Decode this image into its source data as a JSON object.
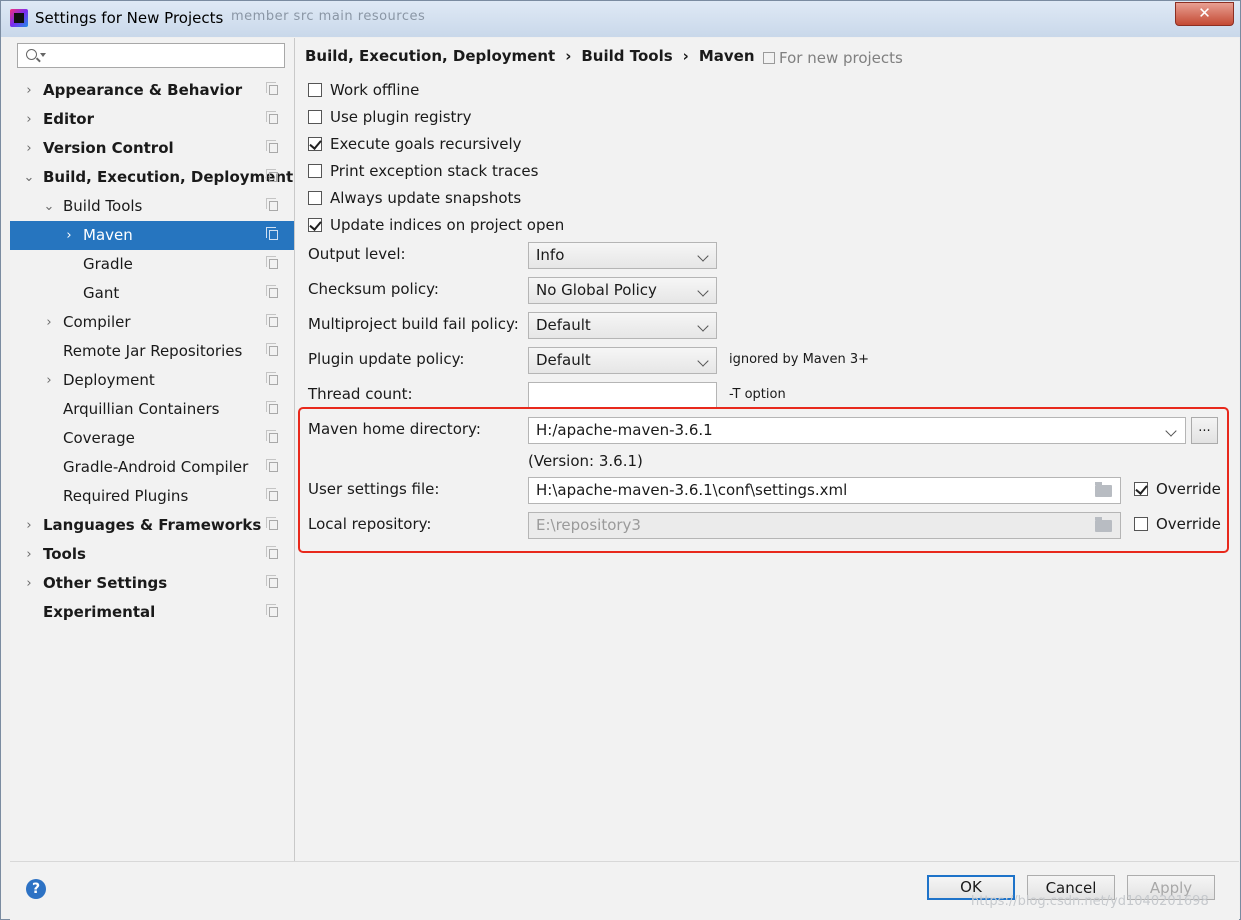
{
  "window": {
    "title": "Settings for New Projects",
    "background_tabs": "member   src   main   resources",
    "close_glyph": "✕"
  },
  "sidebar": {
    "search_placeholder": "",
    "items": [
      {
        "label": "Appearance & Behavior",
        "level": 0,
        "arrow": "›",
        "bold": true,
        "selected": false
      },
      {
        "label": "Editor",
        "level": 0,
        "arrow": "›",
        "bold": true,
        "selected": false
      },
      {
        "label": "Version Control",
        "level": 0,
        "arrow": "›",
        "bold": true,
        "selected": false
      },
      {
        "label": "Build, Execution, Deployment",
        "level": 0,
        "arrow": "⌄",
        "bold": true,
        "selected": false
      },
      {
        "label": "Build Tools",
        "level": 1,
        "arrow": "⌄",
        "bold": false,
        "selected": false
      },
      {
        "label": "Maven",
        "level": 2,
        "arrow": "›",
        "bold": false,
        "selected": true
      },
      {
        "label": "Gradle",
        "level": 2,
        "arrow": "",
        "bold": false,
        "selected": false
      },
      {
        "label": "Gant",
        "level": 2,
        "arrow": "",
        "bold": false,
        "selected": false
      },
      {
        "label": "Compiler",
        "level": 1,
        "arrow": "›",
        "bold": false,
        "selected": false
      },
      {
        "label": "Remote Jar Repositories",
        "level": 1,
        "arrow": "",
        "bold": false,
        "selected": false
      },
      {
        "label": "Deployment",
        "level": 1,
        "arrow": "›",
        "bold": false,
        "selected": false
      },
      {
        "label": "Arquillian Containers",
        "level": 1,
        "arrow": "",
        "bold": false,
        "selected": false
      },
      {
        "label": "Coverage",
        "level": 1,
        "arrow": "",
        "bold": false,
        "selected": false
      },
      {
        "label": "Gradle-Android Compiler",
        "level": 1,
        "arrow": "",
        "bold": false,
        "selected": false
      },
      {
        "label": "Required Plugins",
        "level": 1,
        "arrow": "",
        "bold": false,
        "selected": false
      },
      {
        "label": "Languages & Frameworks",
        "level": 0,
        "arrow": "›",
        "bold": true,
        "selected": false
      },
      {
        "label": "Tools",
        "level": 0,
        "arrow": "›",
        "bold": true,
        "selected": false
      },
      {
        "label": "Other Settings",
        "level": 0,
        "arrow": "›",
        "bold": true,
        "selected": false
      },
      {
        "label": "Experimental",
        "level": 0,
        "arrow": "",
        "bold": true,
        "selected": false
      }
    ]
  },
  "breadcrumb": {
    "items": [
      "Build, Execution, Deployment",
      "Build Tools",
      "Maven"
    ],
    "separator": "›",
    "scope": "For new projects"
  },
  "checkboxes": [
    {
      "label": "Work offline",
      "checked": false
    },
    {
      "label": "Use plugin registry",
      "checked": false
    },
    {
      "label": "Execute goals recursively",
      "checked": true
    },
    {
      "label": "Print exception stack traces",
      "checked": false
    },
    {
      "label": "Always update snapshots",
      "checked": false
    },
    {
      "label": "Update indices on project open",
      "checked": true
    }
  ],
  "fields": {
    "output_level": {
      "label": "Output level:",
      "value": "Info"
    },
    "checksum_policy": {
      "label": "Checksum policy:",
      "value": "No Global Policy"
    },
    "multiproject_fail_policy": {
      "label": "Multiproject build fail policy:",
      "value": "Default"
    },
    "plugin_update_policy": {
      "label": "Plugin update policy:",
      "value": "Default",
      "hint": "ignored by Maven 3+"
    },
    "thread_count": {
      "label": "Thread count:",
      "value": "",
      "hint": "-T option"
    },
    "maven_home": {
      "label": "Maven home directory:",
      "value": "H:/apache-maven-3.6.1",
      "version": "(Version: 3.6.1)",
      "browse_label": "..."
    },
    "user_settings": {
      "label": "User settings file:",
      "value": "H:\\apache-maven-3.6.1\\conf\\settings.xml",
      "override_label": "Override",
      "override_checked": true
    },
    "local_repository": {
      "label": "Local repository:",
      "value": "E:\\repository3",
      "override_label": "Override",
      "override_checked": false
    }
  },
  "footer": {
    "help_label": "?",
    "ok_label": "OK",
    "cancel_label": "Cancel",
    "apply_label": "Apply"
  },
  "watermark": "https://blog.csdn.net/yd1040201698",
  "colors": {
    "selection": "#2675bf",
    "highlight_box": "#e8291c",
    "primary_border": "#1e73c9"
  }
}
